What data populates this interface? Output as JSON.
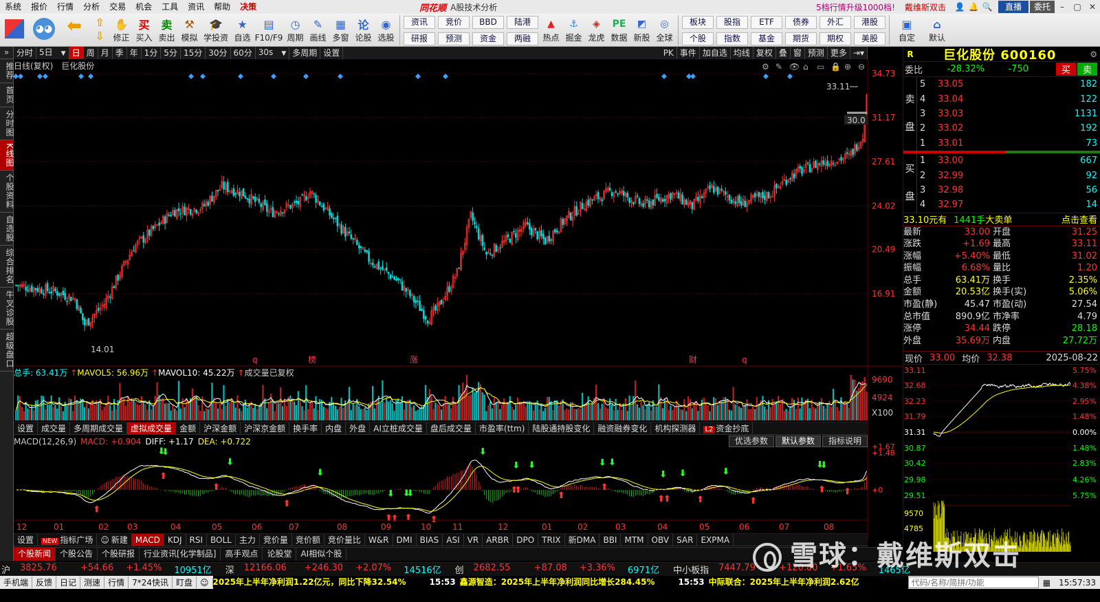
{
  "menu": {
    "items": [
      "系统",
      "报价",
      "行情",
      "分析",
      "交易",
      "机会",
      "工具",
      "资讯",
      "帮助"
    ],
    "hot": "决策",
    "logo": "同花顺",
    "subtitle": "A股技术分析",
    "promo": "5档行情升级1000档!",
    "promo2": "戴维斯双击",
    "zb": "直播",
    "wt": "委托"
  },
  "toolbar": {
    "a": [
      {
        "g": "⇧",
        "l": ""
      },
      {
        "g": "✋",
        "l": "修正"
      },
      {
        "g": "买",
        "l": "买入"
      },
      {
        "g": "卖",
        "l": "卖出"
      },
      {
        "g": "⚒",
        "l": "模拟"
      },
      {
        "g": "🎓",
        "l": "学投资"
      },
      {
        "g": "★",
        "l": "自选"
      },
      {
        "g": "▤",
        "l": "F10/F9"
      },
      {
        "g": "◷",
        "l": "周期"
      },
      {
        "g": "✎",
        "l": "画线"
      },
      {
        "g": "▦",
        "l": "多窗"
      },
      {
        "g": "论",
        "l": "论股"
      },
      {
        "g": "◉",
        "l": "选股"
      }
    ],
    "b": [
      [
        "资讯",
        "研报"
      ],
      [
        "竞价",
        "预测"
      ],
      [
        "BBD",
        "资金"
      ],
      [
        "陆港",
        "两融"
      ]
    ],
    "c": [
      {
        "g": "▲",
        "l": "热点"
      },
      {
        "g": "⚓",
        "l": "掘金"
      },
      {
        "g": "◈",
        "l": "龙虎"
      },
      {
        "g": "PE",
        "l": "数据"
      },
      {
        "g": "◩",
        "l": "新股"
      },
      {
        "g": "◎",
        "l": "全球"
      }
    ],
    "d": [
      [
        "板块",
        "个股"
      ],
      [
        "股指",
        "指数"
      ],
      [
        "ETF",
        "基金"
      ],
      [
        "债券",
        "期货"
      ],
      [
        "外汇",
        "期权"
      ],
      [
        "港股",
        "美股"
      ]
    ],
    "e": [
      {
        "g": "▣",
        "l": "自定"
      },
      {
        "g": "⌂",
        "l": "默认"
      }
    ]
  },
  "lefttabs": [
    "推荐",
    "首页",
    "分时图",
    "K线图",
    "个股资料",
    "自选股",
    "综合排名",
    "牛叉诊股",
    "超级盘口"
  ],
  "periods": [
    "分时",
    "5日",
    "日",
    "周",
    "月",
    "季",
    "年",
    "1分",
    "5分",
    "15分",
    "30分",
    "60分",
    "30s",
    "多周期",
    "设置"
  ],
  "periods_right": [
    "PK",
    "事件",
    "加自选",
    "均线",
    "复权",
    "叠",
    "窗",
    "预测",
    "更多"
  ],
  "chart_head": {
    "label": "日线(复权)",
    "name": "巨化股份"
  },
  "kline": {
    "price_ticks": [
      "34.73",
      "31.17",
      "27.61",
      "24.02",
      "20.49",
      "16.91"
    ],
    "hi_label": "33.11",
    "lo_label": "14.01",
    "last_tag": "30.0",
    "markers": [
      "q",
      "榜",
      "涨",
      "财",
      "q"
    ]
  },
  "volume": {
    "head": "总手: 63.41万",
    "ma5": "MAVOL5: 56.96万",
    "ma10": "MAVOL10: 45.22万",
    "note": "成交量已复权",
    "ticks": [
      "9690",
      "4924",
      "X100"
    ]
  },
  "ind_tabs": [
    "设置",
    "成交量",
    "多周期成交量",
    "虚拟成交量",
    "金额",
    "沪深金额",
    "沪深京金额",
    "换手率",
    "内盘",
    "外盘",
    "AI立桩成交量",
    "盘后成交量",
    "市盈率(ttm)",
    "陆股通持股变化",
    "融资融券变化",
    "机构探测器",
    "资金抄底"
  ],
  "macd": {
    "title": "MACD(12,26,9)",
    "macd": "MACD: +0.904",
    "diff": "DIFF: +1.17",
    "dea": "DEA: +0.722",
    "ticks": [
      "+1.67",
      "+1.48",
      "+0"
    ],
    "btns": [
      "优选参数",
      "默认参数",
      "指标说明"
    ]
  },
  "months": [
    "12",
    "01",
    "02",
    "03",
    "04",
    "05",
    "06",
    "07",
    "08",
    "09",
    "10",
    "11",
    "12",
    "01",
    "02",
    "03",
    "04",
    "05",
    "06",
    "07",
    "08"
  ],
  "ind_tabs2": [
    "设置",
    "指标广场",
    "新建",
    "MACD",
    "KDJ",
    "RSI",
    "BOLL",
    "主力",
    "竞价量",
    "竞价额",
    "竞价量比",
    "W&R",
    "DMI",
    "BIAS",
    "ASI",
    "VR",
    "ARBR",
    "DPO",
    "TRIX",
    "新DMA",
    "BBI",
    "MTM",
    "OBV",
    "SAR",
    "EXPMA"
  ],
  "news_tabs": [
    "个股新闻",
    "个股公告",
    "个股研报",
    "行业资讯[化学制品]",
    "高手观点",
    "论股堂",
    "AI相似个股"
  ],
  "stock": {
    "r": "R",
    "name": "巨化股份 600160",
    "wb_label": "委比",
    "wb_pct": "-28.32%",
    "wb_num": "-750",
    "buy": "买",
    "sell": "卖",
    "asks": [
      [
        "5",
        "33.05",
        "182"
      ],
      [
        "4",
        "33.04",
        "122"
      ],
      [
        "3",
        "33.03",
        "1131"
      ],
      [
        "2",
        "33.02",
        "192"
      ],
      [
        "1",
        "33.01",
        "73"
      ]
    ],
    "bids": [
      [
        "1",
        "33.00",
        "667"
      ],
      [
        "2",
        "32.99",
        "92"
      ],
      [
        "3",
        "32.98",
        "56"
      ],
      [
        "4",
        "32.97",
        "14"
      ]
    ],
    "ticker": {
      "a": "33.10元有",
      "b": "1441手",
      "c": "大卖单",
      "d": "点击查看"
    },
    "stats": [
      [
        "最新",
        "33.00",
        "开盘",
        "31.25"
      ],
      [
        "涨跌",
        "+1.69",
        "最高",
        "33.11"
      ],
      [
        "涨幅",
        "+5.40%",
        "最低",
        "31.02"
      ],
      [
        "振幅",
        "6.68%",
        "量比",
        "1.20"
      ],
      [
        "总手",
        "63.41万",
        "换手",
        "2.35%"
      ],
      [
        "金额",
        "20.53亿",
        "换手(实)",
        "5.06%"
      ],
      [
        "市盈(静)",
        "45.47",
        "市盈(动)",
        "27.54"
      ],
      [
        "总市值",
        "890.9亿",
        "市净率",
        "4.79"
      ],
      [
        "涨停",
        "34.44",
        "跌停",
        "28.18"
      ],
      [
        "外盘",
        "35.69万",
        "内盘",
        "27.72万"
      ]
    ],
    "mini": {
      "xj": "现价",
      "xjv": "33.00",
      "jj": "均价",
      "jjv": "32.38",
      "date": "2025-08-22",
      "left": [
        "33.11",
        "32.68",
        "32.23",
        "31.79",
        "31.31",
        "30.87",
        "30.42",
        "29.98",
        "29.51",
        "9570",
        "4785"
      ],
      "right": [
        "5.75%",
        "4.38%",
        "2.95%",
        "1.48%",
        "0.00%",
        "1.48%",
        "2.83%",
        "4.26%",
        "5.75%"
      ]
    }
  },
  "indexbar": [
    {
      "n": "沪",
      "v": "3825.76",
      "c": "+54.66",
      "p": "+1.45%",
      "a": "10951亿"
    },
    {
      "n": "深",
      "v": "12166.06",
      "c": "+246.30",
      "p": "+2.07%",
      "a": "14516亿"
    },
    {
      "n": "创",
      "v": "2682.55",
      "c": "+87.08",
      "p": "+3.36%",
      "a": "6971亿"
    },
    {
      "n": "中小板指",
      "v": "7447.79",
      "c": "+120.80",
      "p": "+1.65%",
      "a": "1465亿"
    }
  ],
  "bottombar": {
    "tabs": [
      "手机端",
      "反馈",
      "日记",
      "测速",
      "行情",
      "7*24快讯",
      "盯盘"
    ],
    "news": [
      {
        "t": "",
        "s": "2025年上半年净利润1.22亿元，同比下降32.54%"
      },
      {
        "t": "15:53",
        "s": "鑫源智造：2025年上半年净利润同比增长284.45%"
      },
      {
        "t": "15:53",
        "s": "中际联合：2025年上半年净利润2.62亿"
      }
    ],
    "search": "代码/名称/简拼/功能",
    "clock": "15:57:33"
  },
  "watermark": "雪球：戴维斯双击",
  "colors": {
    "up": "#ff3333",
    "down": "#00d8d8",
    "ma5": "#ffffff",
    "ma10": "#ffff00"
  }
}
